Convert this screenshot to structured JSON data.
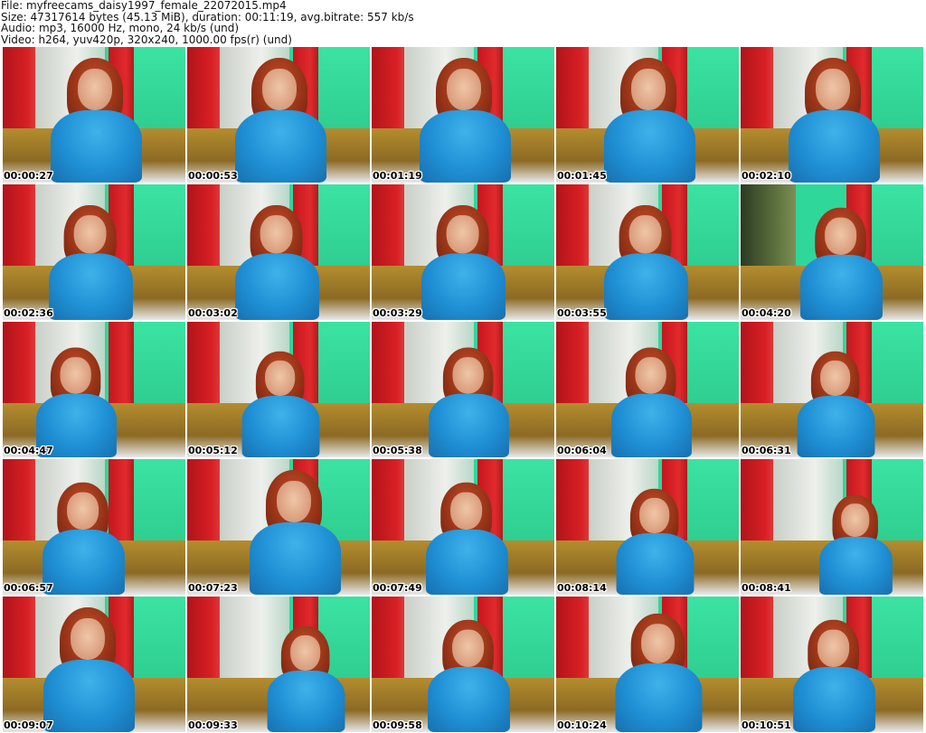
{
  "header": {
    "file": "File: myfreecams_daisy1997_female_22072015.mp4",
    "size": "Size: 47317614 bytes (45.13 MiB), duration: 00:11:19, avg.bitrate: 557 kb/s",
    "audio": "Audio: mp3, 16000 Hz, mono, 24 kb/s (und)",
    "video": "Video: h264, yuv420p, 320x240, 1000.00 fps(r) (und)"
  },
  "thumbnails": [
    {
      "timestamp": "00:00:27"
    },
    {
      "timestamp": "00:00:53"
    },
    {
      "timestamp": "00:01:19"
    },
    {
      "timestamp": "00:01:45"
    },
    {
      "timestamp": "00:02:10"
    },
    {
      "timestamp": "00:02:36"
    },
    {
      "timestamp": "00:03:02"
    },
    {
      "timestamp": "00:03:29"
    },
    {
      "timestamp": "00:03:55"
    },
    {
      "timestamp": "00:04:20"
    },
    {
      "timestamp": "00:04:47"
    },
    {
      "timestamp": "00:05:12"
    },
    {
      "timestamp": "00:05:38"
    },
    {
      "timestamp": "00:06:04"
    },
    {
      "timestamp": "00:06:31"
    },
    {
      "timestamp": "00:06:57"
    },
    {
      "timestamp": "00:07:23"
    },
    {
      "timestamp": "00:07:49"
    },
    {
      "timestamp": "00:08:14"
    },
    {
      "timestamp": "00:08:41"
    },
    {
      "timestamp": "00:09:07"
    },
    {
      "timestamp": "00:09:33"
    },
    {
      "timestamp": "00:09:58"
    },
    {
      "timestamp": "00:10:24"
    },
    {
      "timestamp": "00:10:51"
    }
  ]
}
